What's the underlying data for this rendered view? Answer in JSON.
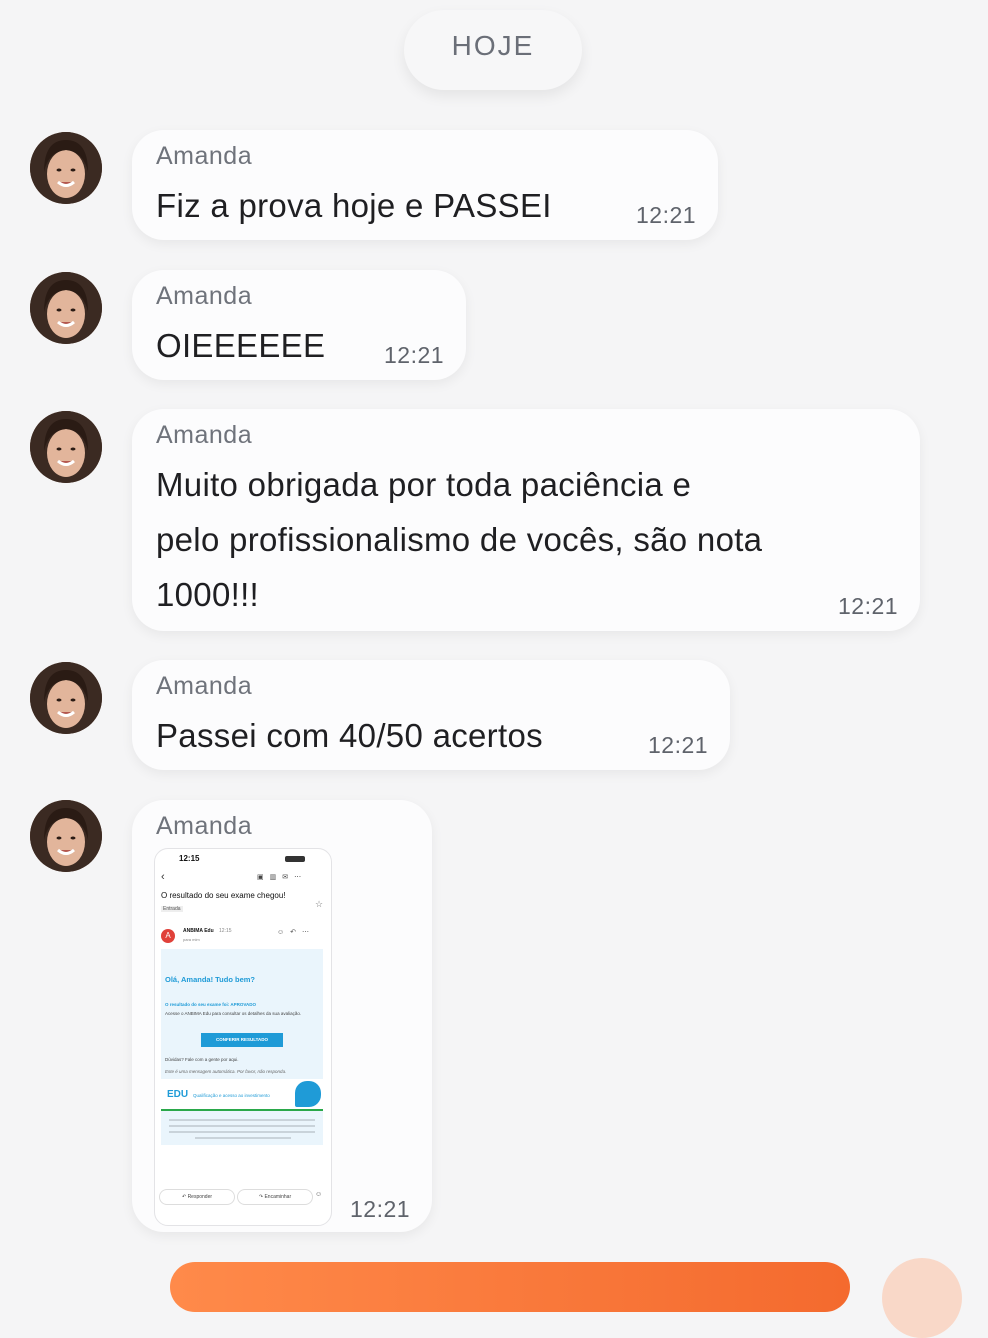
{
  "date_separator": "HOJE",
  "messages": [
    {
      "sender": "Amanda",
      "lines": [
        "Fiz a prova hoje e PASSEI"
      ],
      "time": "12:21"
    },
    {
      "sender": "Amanda",
      "lines": [
        "OIEEEEEE"
      ],
      "time": "12:21"
    },
    {
      "sender": "Amanda",
      "lines": [
        "Muito obrigada por toda paciência e",
        "pelo profissionalismo de vocês, são nota",
        "1000!!!"
      ],
      "time": "12:21"
    },
    {
      "sender": "Amanda",
      "lines": [
        "Passei com 40/50 acertos"
      ],
      "time": "12:21"
    },
    {
      "sender": "Amanda",
      "time": "12:21"
    }
  ],
  "attachment": {
    "status_time": "12:15",
    "subject": "O resultado do seu exame chegou!",
    "folder": "Entrada",
    "from": "ANBIMA Edu",
    "from_time": "12:15",
    "to": "para mim",
    "avatar_letter": "A",
    "greeting": "Olá, Amanda! Tudo bem?",
    "result_line": "O resultado do seu exame foi: APROVADO",
    "instructions": "Acesse o ANBIMA Edu para consultar os detalhes da sua avaliação.",
    "cta": "CONFERIR RESULTADO",
    "help": "Dúvidas? Fale com a gente por aqui.",
    "auto_msg": "Este é uma mensagem automática. Por favor, não responda.",
    "brand": "EDU",
    "brand_tagline": "Qualificação e acesso ao investimento",
    "reply": "Responder",
    "forward": "Encaminhar"
  },
  "colors": {
    "background": "#f5f5f6",
    "bubble": "#fcfcfd",
    "accent": "#f46a2e",
    "email_blue": "#1f9bd7"
  }
}
